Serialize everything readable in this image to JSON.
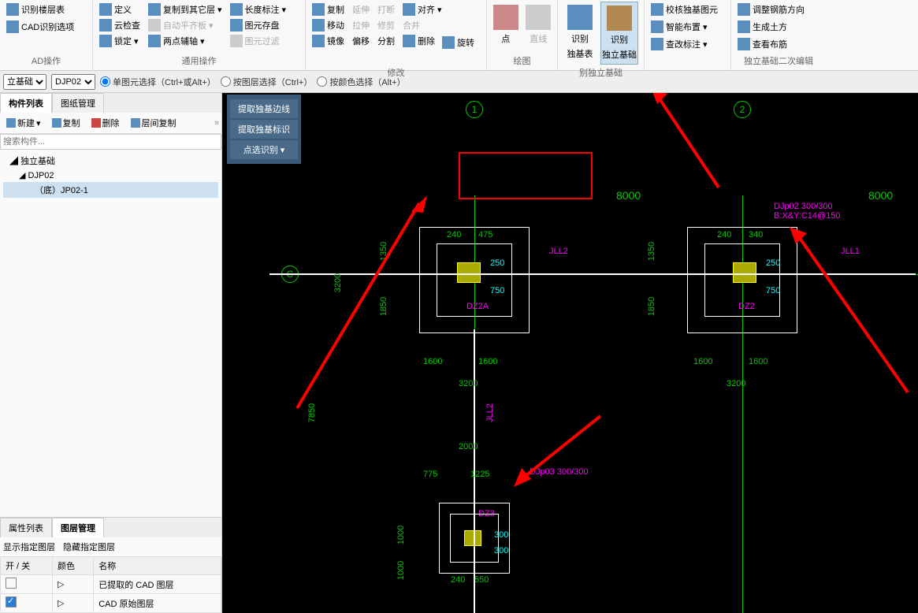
{
  "ribbon": {
    "g1": {
      "btns": [
        "识别楼层表",
        "CAD识别选项"
      ],
      "label": "AD操作"
    },
    "g2": {
      "btns": [
        "定义",
        "云检查",
        "锁定"
      ],
      "btns2": [
        "复制到其它层",
        "自动平齐板",
        "两点辅轴"
      ],
      "btns3": [
        "长度标注",
        "图元存盘",
        "图元过滤"
      ],
      "label": "通用操作"
    },
    "g3": {
      "btns": [
        "复制",
        "移动",
        "镜像"
      ],
      "btns2": [
        "延伸",
        "拉伸",
        "偏移"
      ],
      "btns3": [
        "打断",
        "修剪",
        "分割"
      ],
      "btns4": [
        "对齐",
        "合并",
        "删除",
        "旋转"
      ],
      "label": "修改"
    },
    "g4": {
      "btns": [
        "点",
        "直线"
      ],
      "label": "绘图"
    },
    "g5": {
      "b1": "识别",
      "b1s": "独基表",
      "b2": "识别",
      "b2s": "独立基础",
      "label": "别独立基础"
    },
    "g6": {
      "b1": "校核独基图元",
      "b2": "智能布置",
      "b3": "查改标注",
      "label": ""
    },
    "g7": {
      "b1": "调整钢筋方向",
      "b2": "生成土方",
      "b3": "查看布筋",
      "label": "独立基础二次编辑"
    }
  },
  "selbar": {
    "sel1": "立基础",
    "sel2": "DJP02",
    "r1": "单图元选择（Ctrl+或Alt+）",
    "r2": "按图层选择（Ctrl+）",
    "r3": "按颜色选择（Alt+）"
  },
  "leftpane": {
    "tab1": "构件列表",
    "tab2": "图纸管理",
    "tb": {
      "new": "新建",
      "copy": "复制",
      "del": "删除",
      "layercopy": "层间复制"
    },
    "searchPlaceholder": "搜索构件...",
    "tree": {
      "root": "独立基础",
      "n1": "DJP02",
      "n2": "（底）JP02-1"
    }
  },
  "lower": {
    "tab1": "属性列表",
    "tab2": "图层管理",
    "sub1": "显示指定图层",
    "sub2": "隐藏指定图层",
    "cols": {
      "c1": "开 / 关",
      "c2": "颜色",
      "c3": "名称"
    },
    "rows": [
      {
        "name": "已提取的 CAD 图层",
        "on": false
      },
      {
        "name": "CAD 原始图层",
        "on": true
      }
    ]
  },
  "floatpanel": {
    "b1": "提取独基边线",
    "b2": "提取独基标识",
    "b3": "点选识别"
  },
  "cad": {
    "bubbles": {
      "c": "C",
      "g1": "1",
      "g2": "2"
    },
    "dims": {
      "d8000a": "8000",
      "d8000b": "8000",
      "d1350": "1350",
      "d1850": "1850",
      "d3200": "3200",
      "d240": "240",
      "d475": "475",
      "d250": "250",
      "d750": "750",
      "d340": "340",
      "d1600": "1600",
      "d7850": "7850",
      "d2000": "2000",
      "d775": "775",
      "d1225": "1225",
      "d1000": "1000",
      "d550": "550",
      "d300": "300"
    },
    "labels": {
      "jll1": "JLL1",
      "jll2": "JLL2",
      "dz2a": "DZ2A",
      "dz2": "DZ2",
      "dz3": "DZ3",
      "djp02": "DJp02 300/300",
      "djp02b": "B:X&Y:C14@150",
      "djp03": "DJp03 300/300"
    }
  }
}
